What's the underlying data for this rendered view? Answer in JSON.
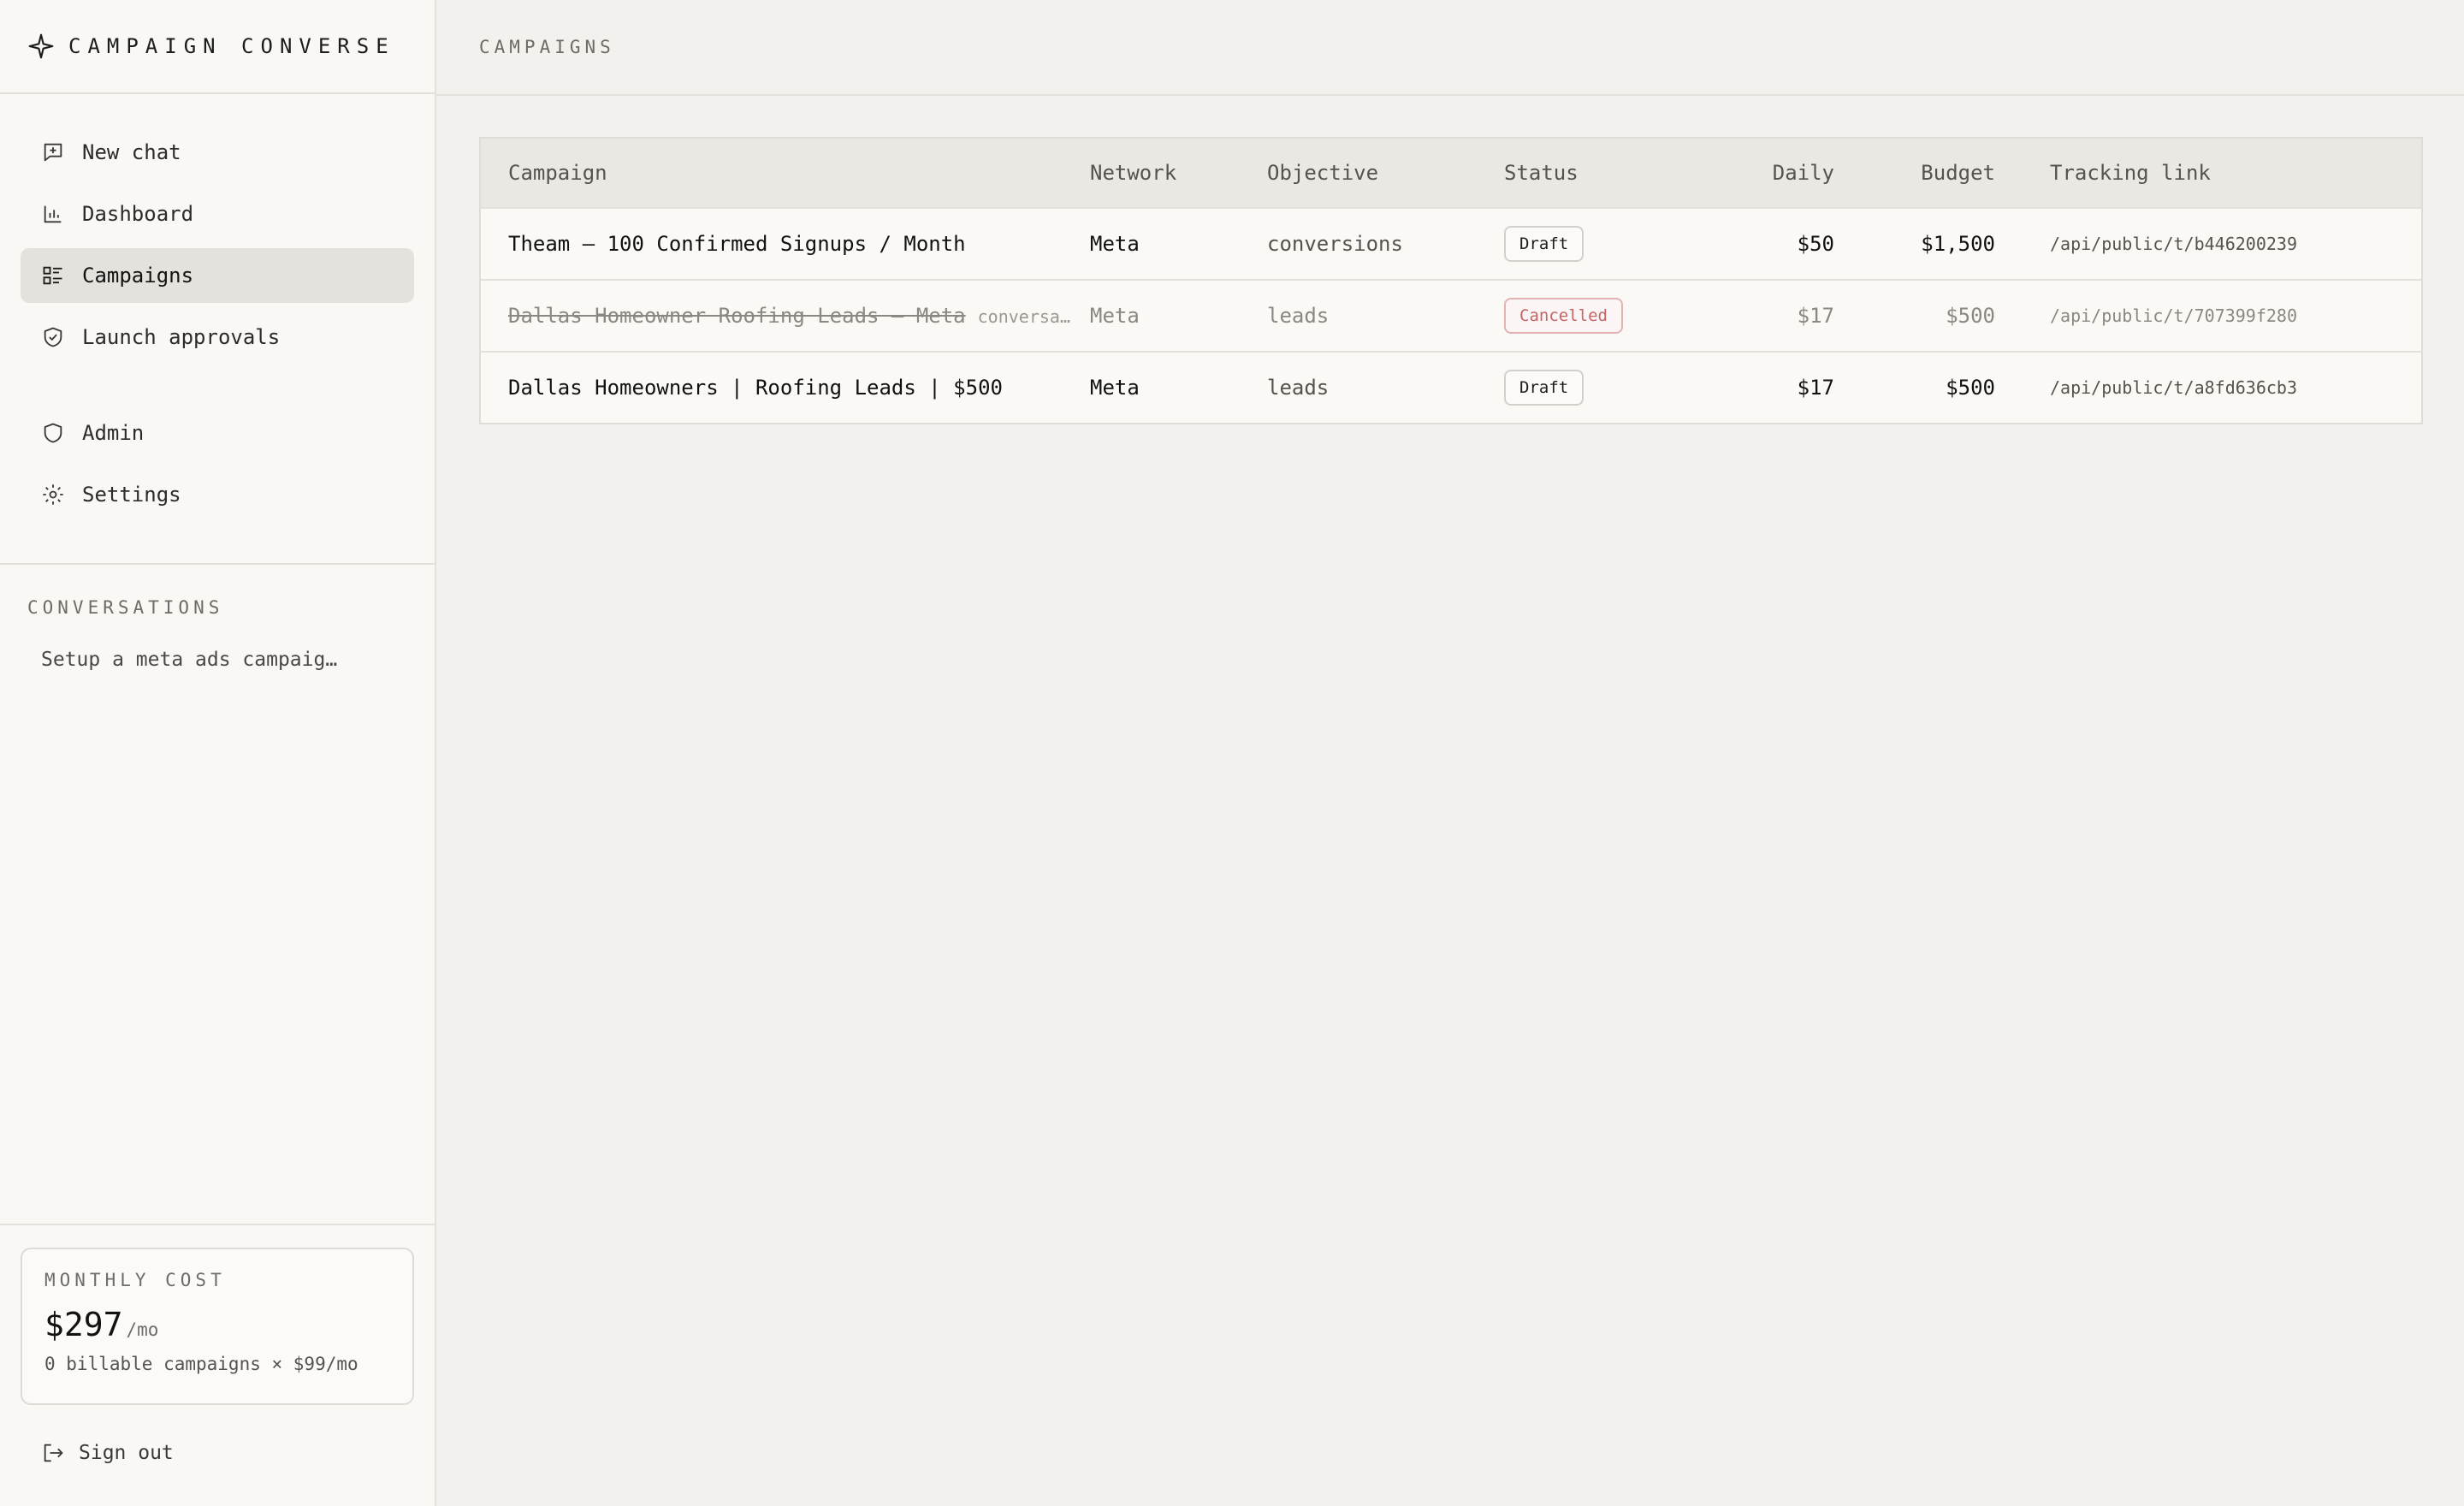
{
  "app": {
    "name": "CAMPAIGN CONVERSE"
  },
  "sidebar": {
    "nav": [
      {
        "label": "New chat",
        "icon": "new-chat-icon"
      },
      {
        "label": "Dashboard",
        "icon": "bar-chart-icon"
      },
      {
        "label": "Campaigns",
        "icon": "campaign-list-icon",
        "active": true
      },
      {
        "label": "Launch approvals",
        "icon": "shield-check-icon"
      }
    ],
    "nav_secondary": [
      {
        "label": "Admin",
        "icon": "shield-icon"
      },
      {
        "label": "Settings",
        "icon": "gear-icon"
      }
    ],
    "conversations_label": "CONVERSATIONS",
    "conversations": [
      "Setup a meta ads campaig…"
    ],
    "cost": {
      "label": "MONTHLY COST",
      "amount": "$297",
      "unit": "/mo",
      "detail": "0 billable campaigns × $99/mo"
    },
    "sign_out": "Sign out"
  },
  "page": {
    "title": "CAMPAIGNS"
  },
  "table": {
    "headers": {
      "campaign": "Campaign",
      "network": "Network",
      "objective": "Objective",
      "status": "Status",
      "daily": "Daily",
      "budget": "Budget",
      "link": "Tracking link"
    },
    "rows": [
      {
        "campaign": "Theam — 100 Confirmed Signups / Month",
        "tag": "",
        "network": "Meta",
        "objective": "conversions",
        "status": "Draft",
        "daily": "$50",
        "budget": "$1,500",
        "link": "/api/public/t/b446200239"
      },
      {
        "campaign": "Dallas Homeowner Roofing Leads — Meta",
        "tag": "conversa…",
        "network": "Meta",
        "objective": "leads",
        "status": "Cancelled",
        "daily": "$17",
        "budget": "$500",
        "link": "/api/public/t/707399f280"
      },
      {
        "campaign": "Dallas Homeowners | Roofing Leads | $500",
        "tag": "",
        "network": "Meta",
        "objective": "leads",
        "status": "Draft",
        "daily": "$17",
        "budget": "$500",
        "link": "/api/public/t/a8fd636cb3"
      }
    ]
  },
  "colors": {
    "background": "#f2f1ed",
    "sidebar": "#f9f8f5",
    "active_nav": "#e4e2dd",
    "cancelled": "#c46464"
  }
}
